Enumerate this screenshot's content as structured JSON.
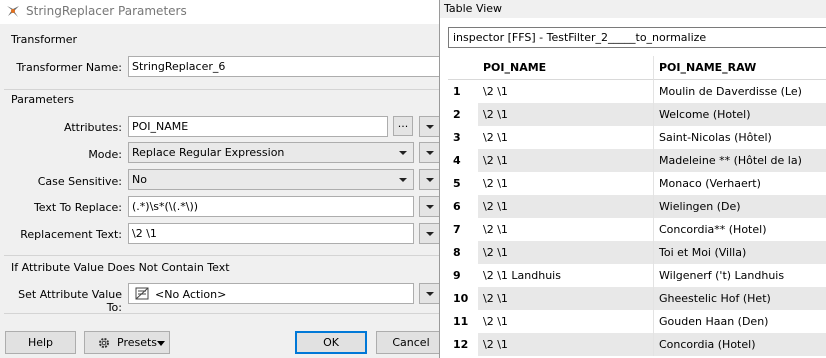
{
  "dialog": {
    "title": "StringReplacer Parameters",
    "transformer_group": "Transformer",
    "transformer_name_label": "Transformer Name:",
    "transformer_name_value": "StringReplacer_6",
    "parameters_group": "Parameters",
    "attributes_label": "Attributes:",
    "attributes_value": "POI_NAME",
    "dots_label": "...",
    "mode_label": "Mode:",
    "mode_value": "Replace Regular Expression",
    "case_label": "Case Sensitive:",
    "case_value": "No",
    "text_to_replace_label": "Text To Replace:",
    "text_to_replace_value": "(.*)\\s*(\\(.*\\))",
    "replacement_label": "Replacement Text:",
    "replacement_value": "\\2 \\1",
    "if_missing_group": "If Attribute Value Does Not Contain Text",
    "set_attr_label": "Set Attribute Value To:",
    "set_attr_value": "<No Action>",
    "help_label": "Help",
    "presets_label": "Presets",
    "ok_label": "OK",
    "cancel_label": "Cancel"
  },
  "table_view": {
    "title": "Table View",
    "selector": "inspector [FFS] - TestFilter_2_____to_normalize",
    "columns": [
      "POI_NAME",
      "POI_NAME_RAW"
    ],
    "rows": [
      {
        "n": "1",
        "poi_name": "\\2 \\1",
        "raw": "Moulin de Daverdisse (Le)"
      },
      {
        "n": "2",
        "poi_name": "\\2 \\1",
        "raw": "Welcome (Hotel)"
      },
      {
        "n": "3",
        "poi_name": "\\2 \\1",
        "raw": "Saint-Nicolas (Hôtel)"
      },
      {
        "n": "4",
        "poi_name": "\\2 \\1",
        "raw": "Madeleine ** (Hôtel de la)"
      },
      {
        "n": "5",
        "poi_name": "\\2 \\1",
        "raw": "Monaco (Verhaert)"
      },
      {
        "n": "6",
        "poi_name": "\\2 \\1",
        "raw": "Wielingen (De)"
      },
      {
        "n": "7",
        "poi_name": "\\2 \\1",
        "raw": "Concordia** (Hotel)"
      },
      {
        "n": "8",
        "poi_name": "\\2 \\1",
        "raw": "Toi et Moi (Villa)"
      },
      {
        "n": "9",
        "poi_name": "\\2 \\1 Landhuis",
        "raw": "Wilgenerf ('t) Landhuis"
      },
      {
        "n": "10",
        "poi_name": "\\2 \\1",
        "raw": "Gheestelic Hof (Het)"
      },
      {
        "n": "11",
        "poi_name": "\\2 \\1",
        "raw": "Gouden Haan (Den)"
      },
      {
        "n": "12",
        "poi_name": "\\2 \\1",
        "raw": "Concordia (Hotel)"
      }
    ]
  }
}
